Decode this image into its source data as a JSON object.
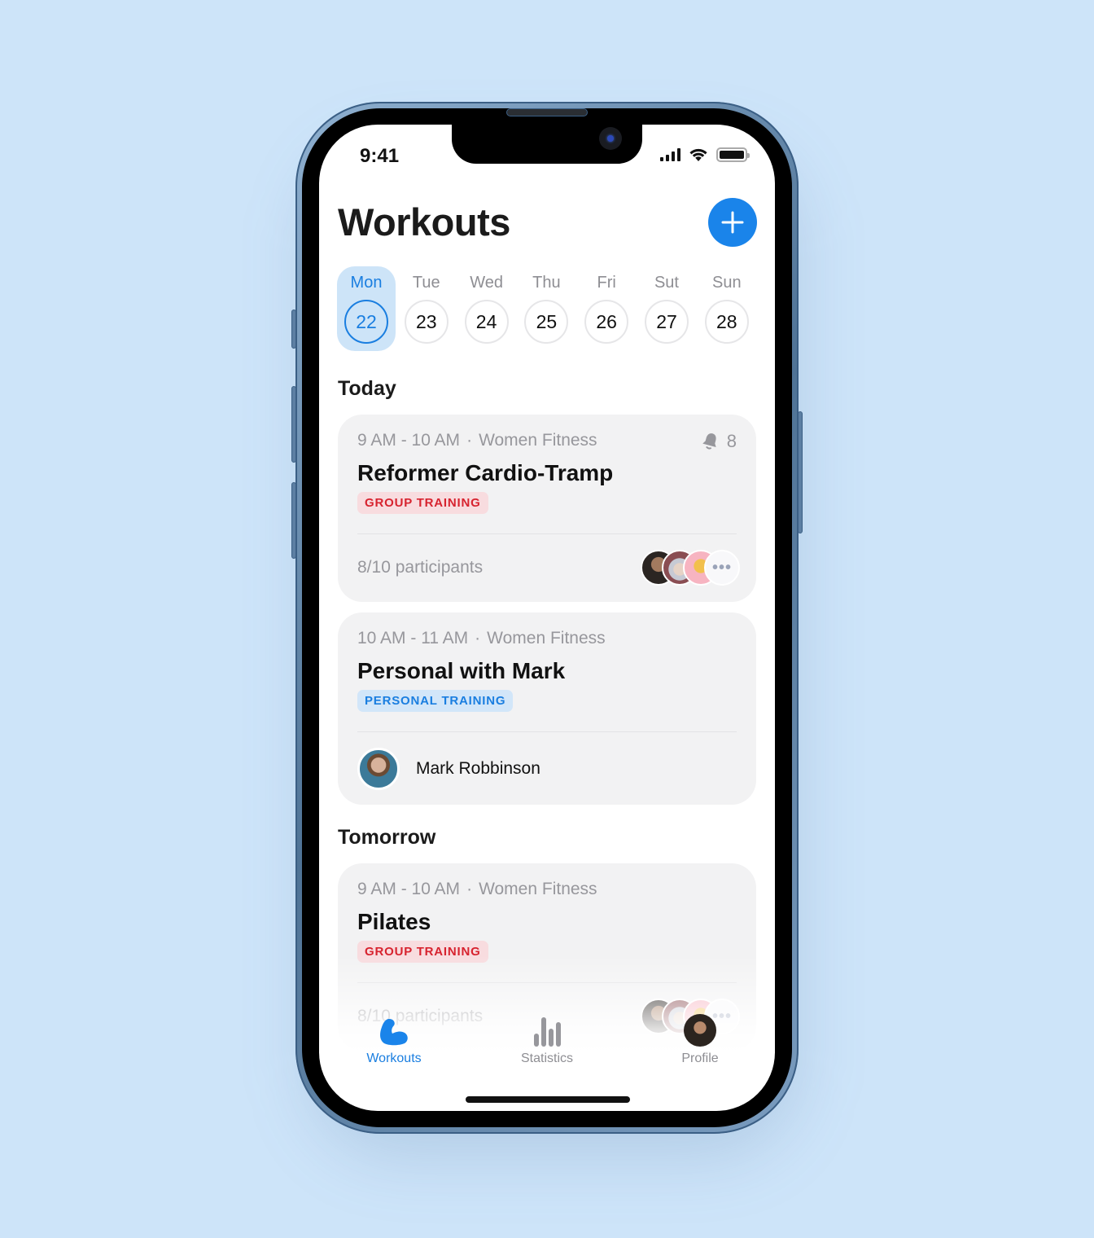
{
  "status_bar": {
    "time": "9:41"
  },
  "header": {
    "title": "Workouts",
    "add_button": "plus-icon"
  },
  "week": [
    {
      "day": "Mon",
      "date": "22",
      "selected": true
    },
    {
      "day": "Tue",
      "date": "23",
      "selected": false
    },
    {
      "day": "Wed",
      "date": "24",
      "selected": false
    },
    {
      "day": "Thu",
      "date": "25",
      "selected": false
    },
    {
      "day": "Fri",
      "date": "26",
      "selected": false
    },
    {
      "day": "Sut",
      "date": "27",
      "selected": false
    },
    {
      "day": "Sun",
      "date": "28",
      "selected": false
    }
  ],
  "sections": {
    "today": "Today",
    "tomorrow": "Tomorrow"
  },
  "cards": [
    {
      "time": "9 AM - 10 AM",
      "separator": "·",
      "category": "Women Fitness",
      "notifications": "8",
      "title": "Reformer Cardio-Tramp",
      "tag": "GROUP TRAINING",
      "participants": "8/10 participants",
      "more": "•••"
    },
    {
      "time": "10 AM - 11 AM",
      "separator": "·",
      "category": "Women Fitness",
      "title": "Personal with Mark",
      "tag": "PERSONAL TRAINING",
      "trainer": "Mark Robbinson"
    },
    {
      "time": "9 AM - 10 AM",
      "separator": "·",
      "category": "Women Fitness",
      "title": "Pilates",
      "tag": "GROUP TRAINING",
      "participants": "8/10 participants",
      "more": "•••"
    }
  ],
  "tabbar": [
    {
      "label": "Workouts",
      "icon": "flexed-bicep-icon",
      "active": true
    },
    {
      "label": "Statistics",
      "icon": "bar-chart-icon",
      "active": false
    },
    {
      "label": "Profile",
      "icon": "avatar",
      "active": false
    }
  ],
  "colors": {
    "accent": "#1a84ea",
    "group_tag_bg": "#f8dcdf",
    "group_tag_text": "#d7232f",
    "personal_tag_bg": "#d2e6f9",
    "personal_tag_text": "#1a7ee0",
    "background": "#cde4f9"
  }
}
